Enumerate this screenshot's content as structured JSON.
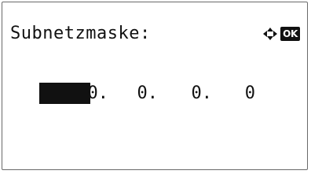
{
  "screen": {
    "title": "Subnetzmaske:",
    "nav_icon": "four-way-arrow-icon",
    "ok_label": "OK"
  },
  "address": {
    "octets": [
      "0.",
      "0.",
      "0.",
      "0"
    ],
    "selected_octet": 1
  },
  "colors": {
    "background": "#ffffff",
    "text": "#111111",
    "cursor": "#111111",
    "border": "#6a6a6a"
  }
}
